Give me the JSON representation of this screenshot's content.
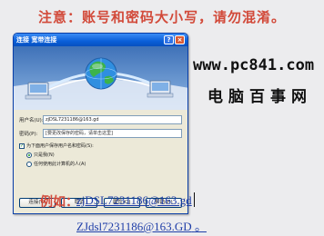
{
  "note": "注意：账号和密码大小写，请勿混淆。",
  "watermark": {
    "url": "www.pc841.com",
    "name": "电脑百事网"
  },
  "dialog": {
    "title": "连接 宽带连接",
    "help_glyph": "?",
    "close_glyph": "×",
    "username_label": "用户名(U):",
    "username_value": "zjDSL7231186@163.gd",
    "password_label": "密码(P):",
    "password_value": "[要更改保存的密码，请单击这里]",
    "save_checkbox": "为下面用户保存用户名和密码(S):",
    "radio_me": "只是我(N)",
    "radio_anyone": "任何使用此计算机的人(A)",
    "buttons": {
      "connect": "连接(C)",
      "cancel": "取消",
      "properties": "属性(O)",
      "help": "帮助(H)"
    }
  },
  "example": {
    "label": "例如：",
    "lower": "zjDSL7231186@163.gd",
    "upper": "ZJdsl7231186@163.GD",
    "trailing_mark": "。"
  },
  "colors": {
    "note_red": "#d24a3a",
    "example_blue": "#1f3ea8",
    "xp_title_blue": "#0a5fd8"
  }
}
